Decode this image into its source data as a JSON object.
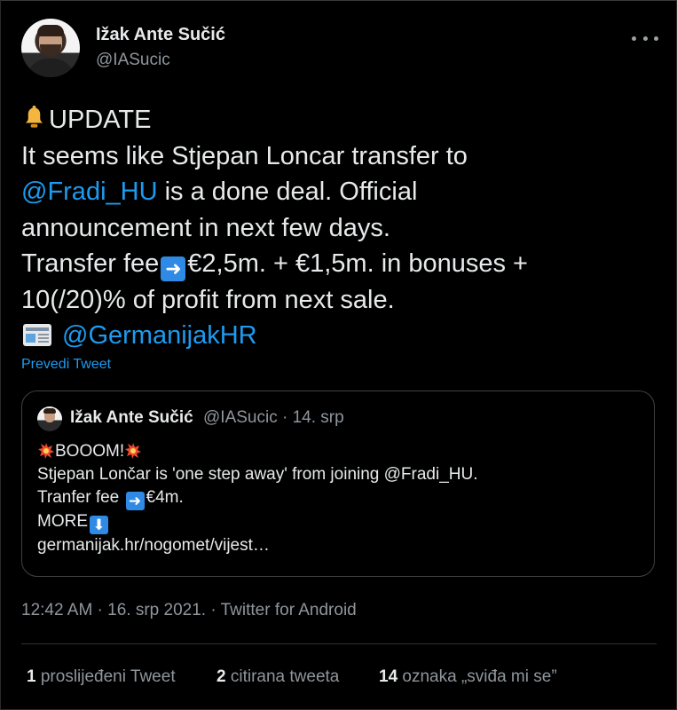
{
  "tweet": {
    "author": {
      "name": "Ižak Ante Sučić",
      "handle": "@IASucic"
    },
    "lines": {
      "l1": "UPDATE",
      "l2": "It seems like Stjepan Loncar transfer to",
      "l3_link": "@Fradi_HU",
      "l3_rest": " is a done deal. Official",
      "l4": "announcement in next few days.",
      "l5_a": "Transfer fee",
      "l5_b": "€2,5m. + €1,5m. in bonuses +",
      "l6": "10(/20)% of profit from next sale.",
      "l7_link": "@GermanijakHR"
    },
    "translate_label": "Prevedi Tweet",
    "timestamp": "12:42 AM · 16. srp 2021. · Twitter for Android"
  },
  "quoted": {
    "author": {
      "name": "Ižak Ante Sučić",
      "meta": "@IASucic · 14. srp"
    },
    "lines": {
      "boom": "BOOOM!",
      "l2": "Stjepan Lončar is 'one step away' from joining @Fradi_HU.",
      "l3_a": "Tranfer fee",
      "l3_b": "€4m.",
      "l4": "MORE",
      "l5": "germanijak.hr/nogomet/vijest…"
    }
  },
  "stats": {
    "retweets_count": "1",
    "retweets_label": " proslijeđeni Tweet",
    "quotes_count": "2",
    "quotes_label": " citirana tweeta",
    "likes_count": "14",
    "likes_label": " oznaka „sviđa mi se”"
  },
  "icons": {
    "bell": "bell-emoji",
    "arrow_right": "right-arrow-emoji",
    "arrow_down": "down-arrow-emoji",
    "newspaper": "newspaper-emoji",
    "collision": "collision-emoji",
    "more": "more-options-icon"
  },
  "colors": {
    "background": "#000000",
    "link": "#1d9bf0",
    "secondary_text": "#8f969c",
    "emoji_box": "#2f8ae5"
  }
}
